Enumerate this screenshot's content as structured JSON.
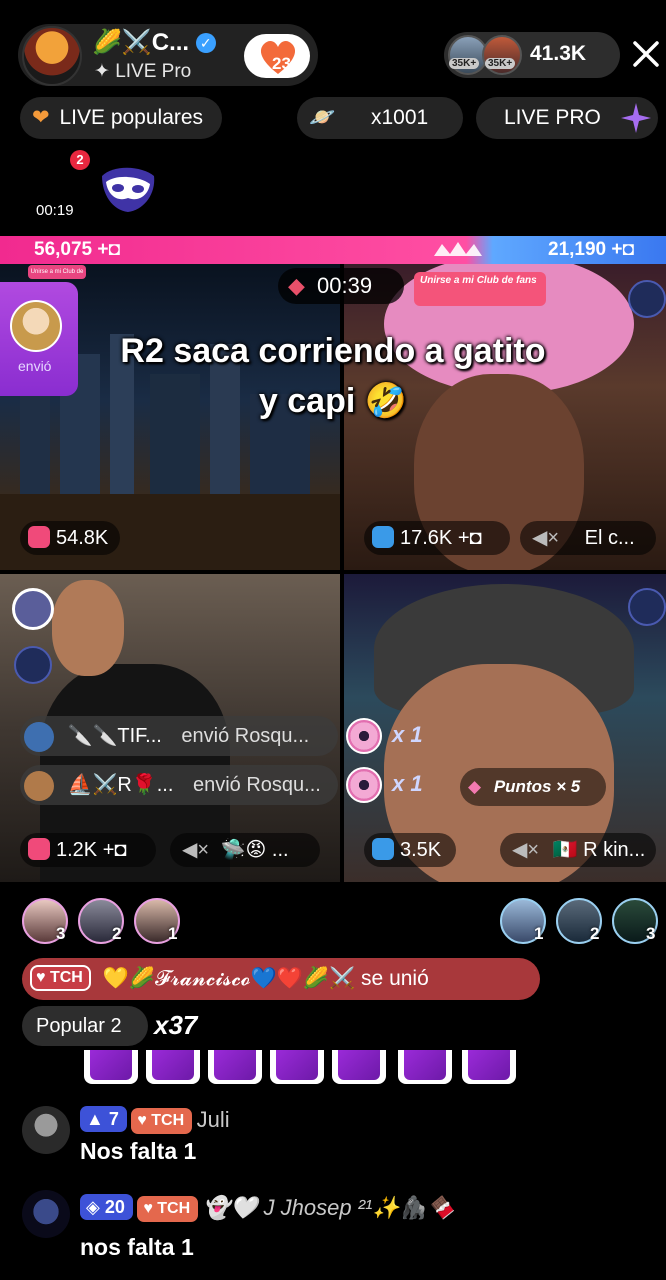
{
  "header": {
    "host_name": "🌽⚔️C...",
    "host_subtitle": "✦ LIVE Pro",
    "fan_level": "23",
    "viewer_badges": [
      "35K+",
      "35K+"
    ],
    "viewer_count": "41.3K"
  },
  "pills": {
    "popular": "LIVE populares",
    "multiplier": "x1001",
    "live_pro": "LIVE PRO"
  },
  "notification": {
    "count": "2",
    "timer": "00:19"
  },
  "battle": {
    "score_left": "56,075",
    "score_right": "21,190",
    "timer": "00:39",
    "caption_line1": "R2 saca corriendo a gatito",
    "caption_line2": "y capi 🤣",
    "gift_label": "envió",
    "club_tag": "Unirse a mi Club de fans"
  },
  "tiles": {
    "t1_stat": "54.8K",
    "t2_stat": "17.6K",
    "t2_label": "El c...",
    "t3_stat": "1.2K",
    "t3_emoji": "🛸😡 ...",
    "t4_stat": "3.5K",
    "t4_label": "🇲🇽 R kin..."
  },
  "events": [
    {
      "name": "🔪🔪TIF...",
      "action": "envió Rosqu...",
      "combo": "x 1"
    },
    {
      "name": "⛵⚔️R🌹...",
      "action": "envió Rosqu...",
      "combo": "x 1"
    }
  ],
  "points": "Puntos × 5",
  "rankings": {
    "left": [
      "3",
      "2",
      "1"
    ],
    "right": [
      "1",
      "2",
      "3"
    ]
  },
  "joined": {
    "badge": "TCH",
    "text": "💛🌽𝓕𝓻𝓪𝓷𝓬𝓲𝓼𝓬𝓸💙❤️🌽⚔️ se unió"
  },
  "popular_rank": "Popular 2",
  "combo_count": "x37",
  "chat": [
    {
      "level": "7",
      "badge": "TCH",
      "name": "Juli",
      "message": "Nos falta 1"
    },
    {
      "level": "20",
      "badge": "TCH",
      "name": "👻🤍 J Jhosep ²¹✨🦍🍫",
      "message": "nos falta 1"
    }
  ],
  "colors": {
    "battle_left": "#f12a8f",
    "battle_right": "#3a78f0",
    "joined_bg": "#a8383b",
    "level_badge": "#3d52d8"
  }
}
